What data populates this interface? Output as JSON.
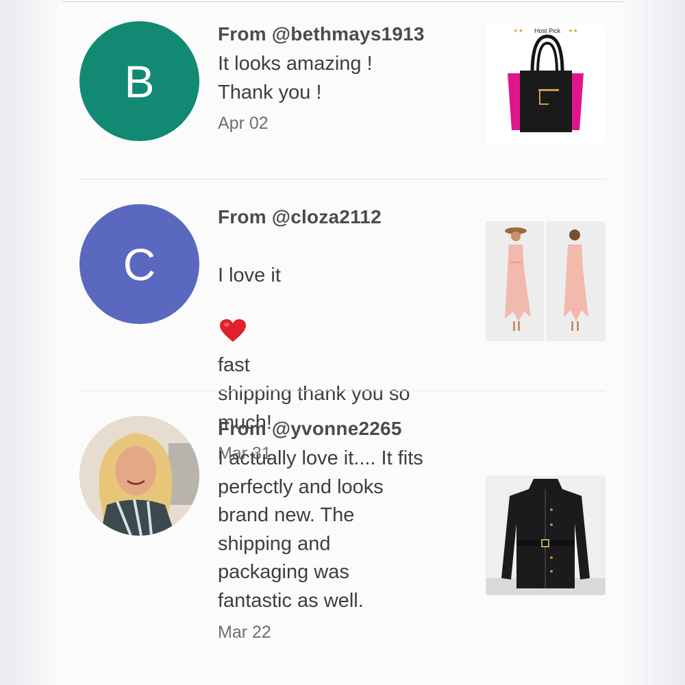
{
  "reviews": [
    {
      "from": "From @bethmays1913",
      "message": "It looks amazing !\nThank you !",
      "date": "Apr 02",
      "avatar_letter": "B",
      "avatar_color": "#128a73",
      "thumb_label": "Host Pick"
    },
    {
      "from": "From @cloza2112",
      "message_part1": "I love it",
      "message_part2": "fast\nshipping thank you so\nmuch!",
      "date": "Mar 31",
      "avatar_letter": "C",
      "avatar_color": "#5b68c0"
    },
    {
      "from": "From @yvonne2265",
      "message": "I actually love it.... It fits\nperfectly and looks\nbrand new. The\nshipping and\npackaging was\nfantastic as well.",
      "date": "Mar 22"
    }
  ],
  "colors": {
    "text_primary": "#4b4b4f",
    "text_date": "#6d6d72",
    "divider": "#e6e6e8",
    "heart": "#e0202c"
  },
  "icons": [
    "heart-emoji-icon"
  ]
}
